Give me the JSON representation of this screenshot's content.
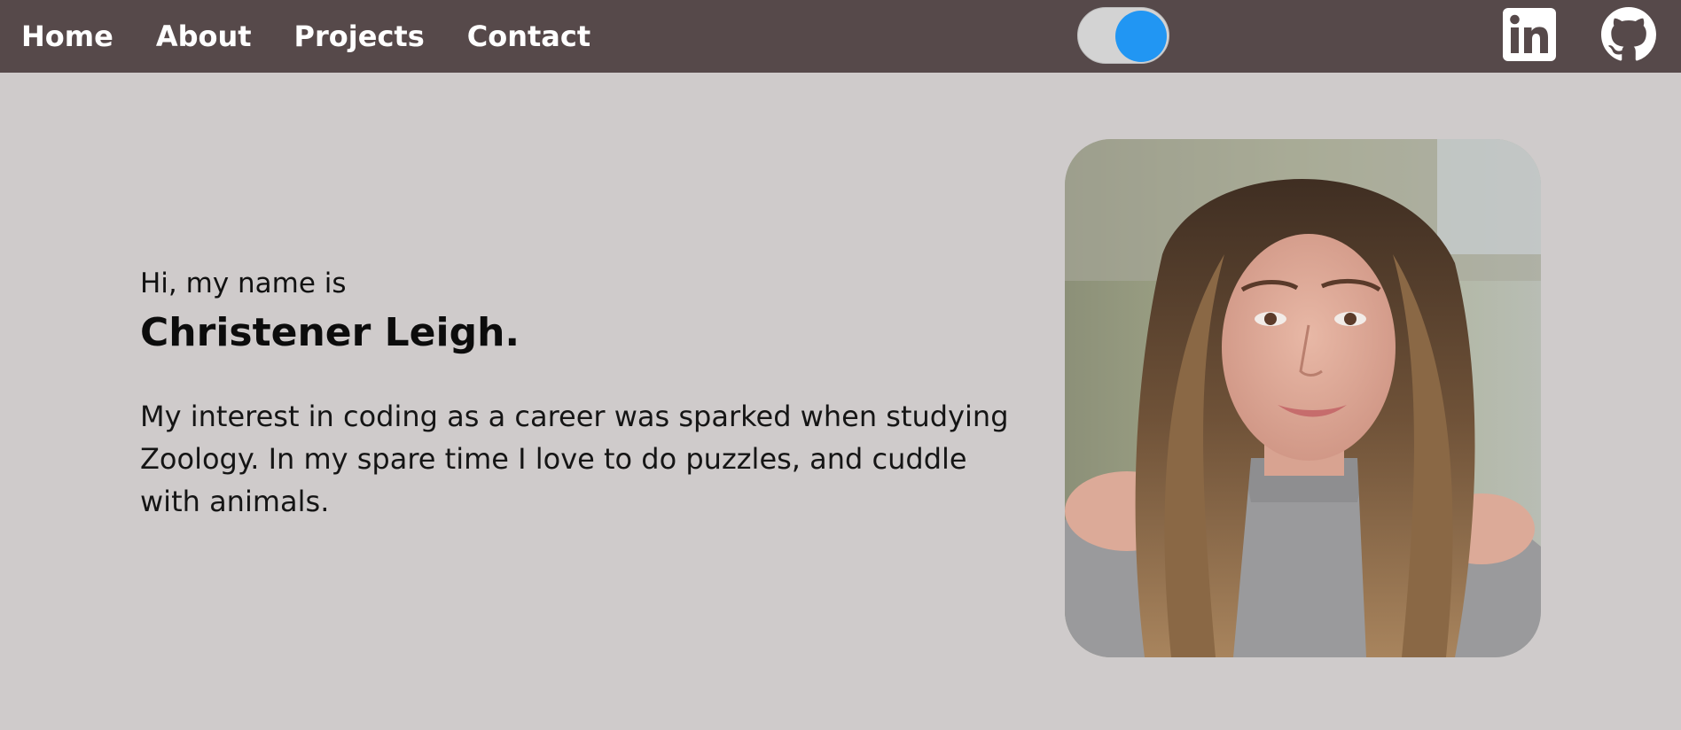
{
  "nav": {
    "links": [
      {
        "label": "Home"
      },
      {
        "label": "About"
      },
      {
        "label": "Projects"
      },
      {
        "label": "Contact"
      }
    ],
    "theme_toggle": {
      "state": "on",
      "knob_color": "#2196f3"
    },
    "social": [
      {
        "icon": "linkedin-icon"
      },
      {
        "icon": "github-icon"
      }
    ]
  },
  "hero": {
    "greeting": "Hi, my name is",
    "name": "Christener Leigh.",
    "bio": "My interest in coding as a career was sparked when studying Zoology. In my spare time I love to do puzzles, and cuddle with animals."
  },
  "colors": {
    "navbar": "#56494a",
    "background": "#cfcbcb",
    "toggle_accent": "#2196f3"
  }
}
